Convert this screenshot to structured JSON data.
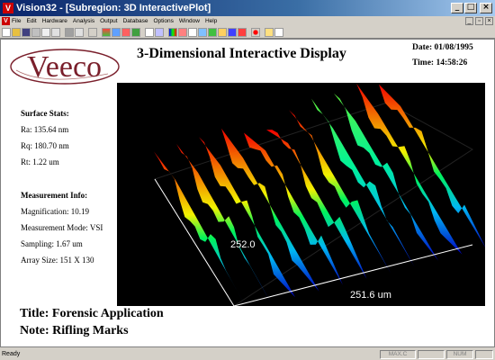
{
  "window": {
    "title": "Vision32 - [Subregion: 3D InteractivePlot]",
    "app_icon": "V",
    "controls": [
      "minimize",
      "maximize",
      "close"
    ]
  },
  "menu": {
    "items": [
      "File",
      "Edit",
      "Hardware",
      "Analysis",
      "Output",
      "Database",
      "Options",
      "Window",
      "Help"
    ]
  },
  "toolbar": {
    "buttons": [
      "new-icon",
      "open-icon",
      "save-icon",
      "print-icon",
      "copy-icon",
      "export-icon",
      "settings-icon",
      "list-icon",
      "star-icon",
      "grid-icon",
      "measure-icon",
      "chart-icon",
      "stack-icon",
      "plot2d-icon",
      "plot3d-icon",
      "color-icon",
      "histogram-icon",
      "profile-icon",
      "filter-icon",
      "mask-icon",
      "info-icon",
      "region-icon",
      "zoom-icon",
      "red-dot-icon",
      "calc-icon",
      "help-icon"
    ]
  },
  "logo": {
    "text": "Veeco",
    "brand_color": "#7a1f2b"
  },
  "header": {
    "title": "3-Dimensional Interactive Display",
    "date": "Date: 01/08/1995",
    "time": "Time: 14:58:26"
  },
  "surface_stats": {
    "heading": "Surface Stats:",
    "ra": "Ra: 135.64 nm",
    "rq": "Rq: 180.70 nm",
    "rt": "Rt: 1.22 um"
  },
  "measurement_info": {
    "heading": "Measurement Info:",
    "magnification": "Magnification: 10.19",
    "mode": "Measurement Mode: VSI",
    "sampling": "Sampling: 1.67 um",
    "array_size": "Array Size: 151 X 130"
  },
  "plot": {
    "y_extent_label": "252.0",
    "x_extent_label": "251.6 um",
    "colors": [
      "#0000cc",
      "#00c0ff",
      "#00ff60",
      "#ffff00",
      "#ff8000",
      "#ff0000"
    ]
  },
  "footer": {
    "title": "Title: Forensic Application",
    "note": "Note: Rifling Marks"
  },
  "statusbar": {
    "ready": "Ready",
    "panels": [
      "MAX.C",
      "NUM",
      ""
    ]
  }
}
